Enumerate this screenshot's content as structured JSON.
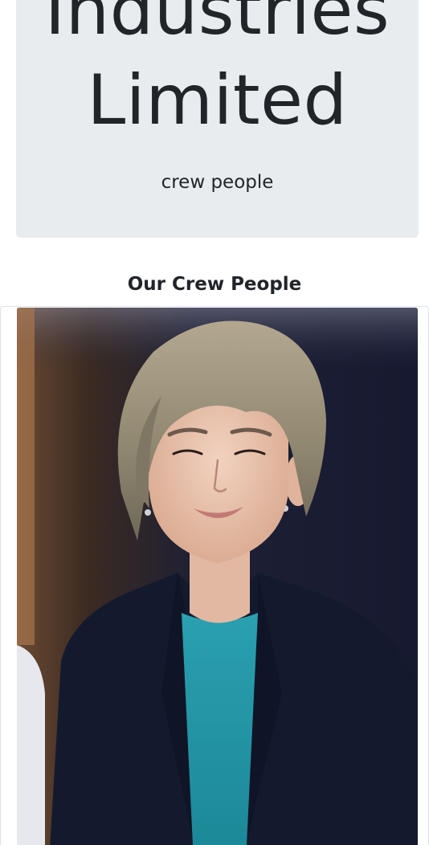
{
  "hero": {
    "title_line_1": "Industries",
    "title_line_2": "Limited",
    "subtitle": "crew people"
  },
  "crew_section": {
    "heading": "Our Crew People"
  },
  "colors": {
    "hero_background": "#e9ecef",
    "text": "#212529",
    "card_border": "#dee2e6"
  }
}
